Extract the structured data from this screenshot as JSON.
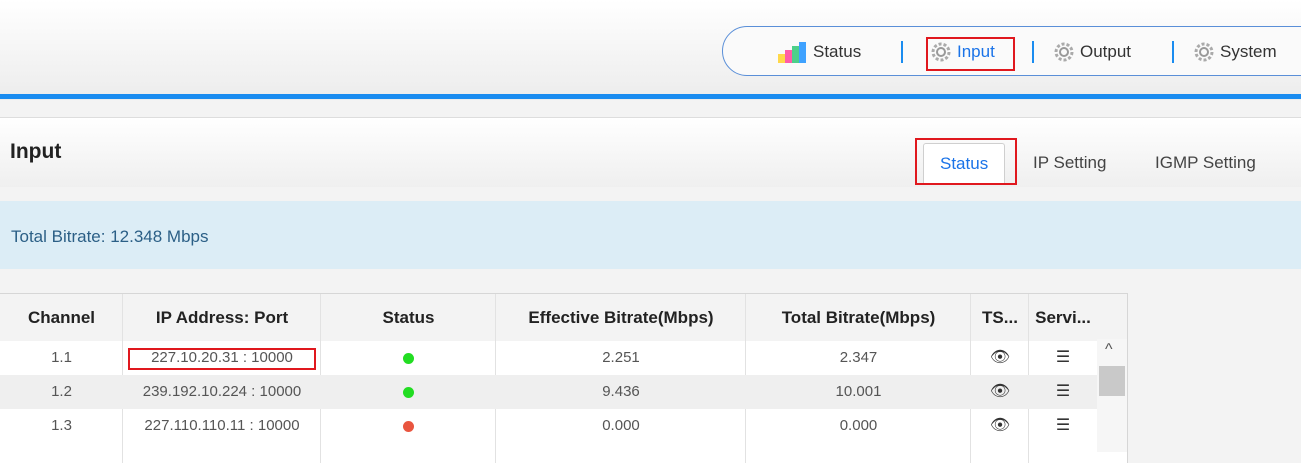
{
  "nav": {
    "items": [
      {
        "label": "Status",
        "icon": "bar-chart-icon"
      },
      {
        "label": "Input",
        "icon": "gear-icon",
        "active": true
      },
      {
        "label": "Output",
        "icon": "gear-icon"
      },
      {
        "label": "System",
        "icon": "gear-icon"
      }
    ]
  },
  "page": {
    "title": "Input",
    "tabs": [
      {
        "label": "Status",
        "active": true
      },
      {
        "label": "IP Setting"
      },
      {
        "label": "IGMP Setting"
      }
    ]
  },
  "info": {
    "total_bitrate": "Total Bitrate:  12.348 Mbps"
  },
  "table": {
    "headers": [
      "Channel",
      "IP Address: Port",
      "Status",
      "Effective Bitrate(Mbps)",
      "Total Bitrate(Mbps)",
      "TS...",
      "Servi..."
    ],
    "rows": [
      {
        "channel": "1.1",
        "ip": "227.10.20.31 : 10000",
        "status": "green",
        "effective": "2.251",
        "total": "2.347"
      },
      {
        "channel": "1.2",
        "ip": "239.192.10.224 : 10000",
        "status": "green",
        "effective": "9.436",
        "total": "10.001"
      },
      {
        "channel": "1.3",
        "ip": "227.110.110.11 : 10000",
        "status": "red",
        "effective": "0.000",
        "total": "0.000"
      }
    ]
  },
  "colors": {
    "accent": "#1a8cf0",
    "highlight": "#e0181e",
    "status_ok": "#22dd22",
    "status_error": "#e9553f"
  }
}
